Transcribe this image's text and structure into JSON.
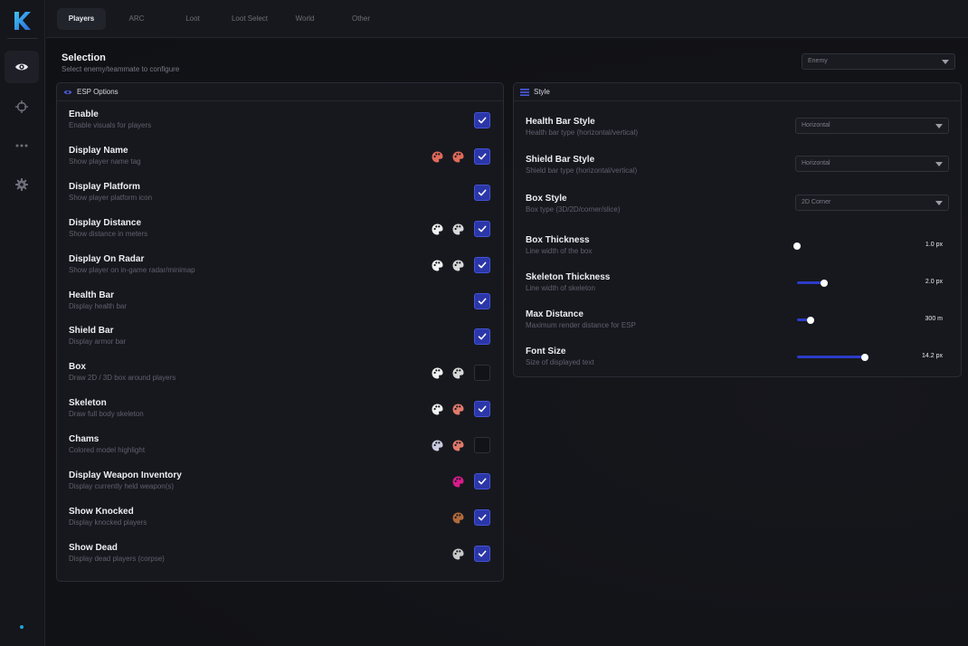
{
  "app": {
    "logo_letter": "K"
  },
  "sidebar": {
    "items": [
      {
        "icon": "eye-icon",
        "active": true
      },
      {
        "icon": "crosshair-icon",
        "active": false
      },
      {
        "icon": "more-dots-icon",
        "active": false
      },
      {
        "icon": "gear-icon",
        "active": false
      }
    ]
  },
  "tabs": [
    {
      "label": "Players",
      "active": true
    },
    {
      "label": "ARC",
      "active": false
    },
    {
      "label": "Loot",
      "active": false
    },
    {
      "label": "Loot Select",
      "active": false
    },
    {
      "label": "World",
      "active": false
    },
    {
      "label": "Other",
      "active": false
    }
  ],
  "selection": {
    "title": "Selection",
    "subtitle": "Select enemy/teammate to configure",
    "value": "Enemy"
  },
  "esp": {
    "title": "ESP Options",
    "options": [
      {
        "label": "Enable",
        "desc": "Enable visuals for players",
        "checked": true,
        "colors": []
      },
      {
        "label": "Display Name",
        "desc": "Show player name tag",
        "checked": true,
        "colors": [
          "#e06a5a",
          "#e06a5a"
        ]
      },
      {
        "label": "Display Platform",
        "desc": "Show player platform icon",
        "checked": true,
        "colors": []
      },
      {
        "label": "Display Distance",
        "desc": "Show distance in meters",
        "checked": true,
        "colors": [
          "#f2f2f2",
          "#d8d8d8"
        ]
      },
      {
        "label": "Display On Radar",
        "desc": "Show player on in-game radar/minimap",
        "checked": true,
        "colors": [
          "#f2f2f2",
          "#d8d8d8"
        ]
      },
      {
        "label": "Health Bar",
        "desc": "Display health bar",
        "checked": true,
        "colors": []
      },
      {
        "label": "Shield Bar",
        "desc": "Display armor bar",
        "checked": true,
        "colors": []
      },
      {
        "label": "Box",
        "desc": "Draw 2D / 3D box around players",
        "checked": false,
        "colors": [
          "#f2f2f2",
          "#d8d8d8"
        ]
      },
      {
        "label": "Skeleton",
        "desc": "Draw full body skeleton",
        "checked": true,
        "colors": [
          "#f2f2f2",
          "#e07a6a"
        ]
      },
      {
        "label": "Chams",
        "desc": "Colored model highlight",
        "checked": false,
        "colors": [
          "#c8cbe0",
          "#e07a6a"
        ]
      },
      {
        "label": "Display Weapon Inventory",
        "desc": "Display currently held weapon(s)",
        "checked": true,
        "colors": [
          "#d81b8a"
        ]
      },
      {
        "label": "Show Knocked",
        "desc": "Display knocked players",
        "checked": true,
        "colors": [
          "#b06a3a"
        ]
      },
      {
        "label": "Show Dead",
        "desc": "Display dead players (corpse)",
        "checked": true,
        "colors": [
          "#c8c8c8"
        ]
      }
    ]
  },
  "style": {
    "title": "Style",
    "dropdowns": [
      {
        "label": "Health Bar Style",
        "desc": "Health bar type (horizontal/vertical)",
        "value": "Horizontal"
      },
      {
        "label": "Shield Bar Style",
        "desc": "Shield bar type (horizontal/vertical)",
        "value": "Horizontal"
      },
      {
        "label": "Box Style",
        "desc": "Box type (3D/2D/corner/slice)",
        "value": "2D Corner"
      }
    ],
    "sliders": [
      {
        "label": "Box Thickness",
        "desc": "Line width of the box",
        "value": "1.0 px",
        "fraction": 0.0
      },
      {
        "label": "Skeleton Thickness",
        "desc": "Line width of skeleton",
        "value": "2.0 px",
        "fraction": 0.4
      },
      {
        "label": "Max Distance",
        "desc": "Maximum render distance for ESP",
        "value": "300 m",
        "fraction": 0.2
      },
      {
        "label": "Font Size",
        "desc": "Size of displayed text",
        "value": "14.2 px",
        "fraction": 1.0
      }
    ]
  },
  "colors": {
    "accent": "#2b36a8",
    "accent_border": "#4453d6",
    "slider": "#2c3cc8",
    "status_dot": "#1fa3d8"
  }
}
